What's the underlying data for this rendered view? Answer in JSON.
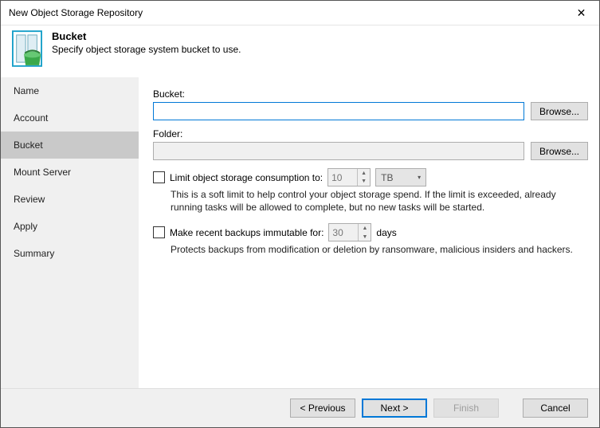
{
  "window": {
    "title": "New Object Storage Repository"
  },
  "header": {
    "title": "Bucket",
    "subtitle": "Specify object storage system bucket to use."
  },
  "sidebar": {
    "items": [
      {
        "label": "Name",
        "selected": false
      },
      {
        "label": "Account",
        "selected": false
      },
      {
        "label": "Bucket",
        "selected": true
      },
      {
        "label": "Mount Server",
        "selected": false
      },
      {
        "label": "Review",
        "selected": false
      },
      {
        "label": "Apply",
        "selected": false
      },
      {
        "label": "Summary",
        "selected": false
      }
    ]
  },
  "form": {
    "bucket_label": "Bucket:",
    "bucket_value": "",
    "bucket_browse": "Browse...",
    "folder_label": "Folder:",
    "folder_value": "",
    "folder_browse": "Browse...",
    "limit": {
      "label": "Limit object storage consumption to:",
      "value": "10",
      "unit": "TB",
      "help": "This is a soft limit to help control your object storage spend. If the limit is exceeded, already running tasks will be allowed to complete, but no new tasks will be started."
    },
    "immut": {
      "label": "Make recent backups immutable for:",
      "value": "30",
      "unit": "days",
      "help": "Protects backups from modification or deletion by ransomware, malicious insiders and hackers."
    }
  },
  "footer": {
    "previous": "< Previous",
    "next": "Next >",
    "finish": "Finish",
    "cancel": "Cancel"
  }
}
